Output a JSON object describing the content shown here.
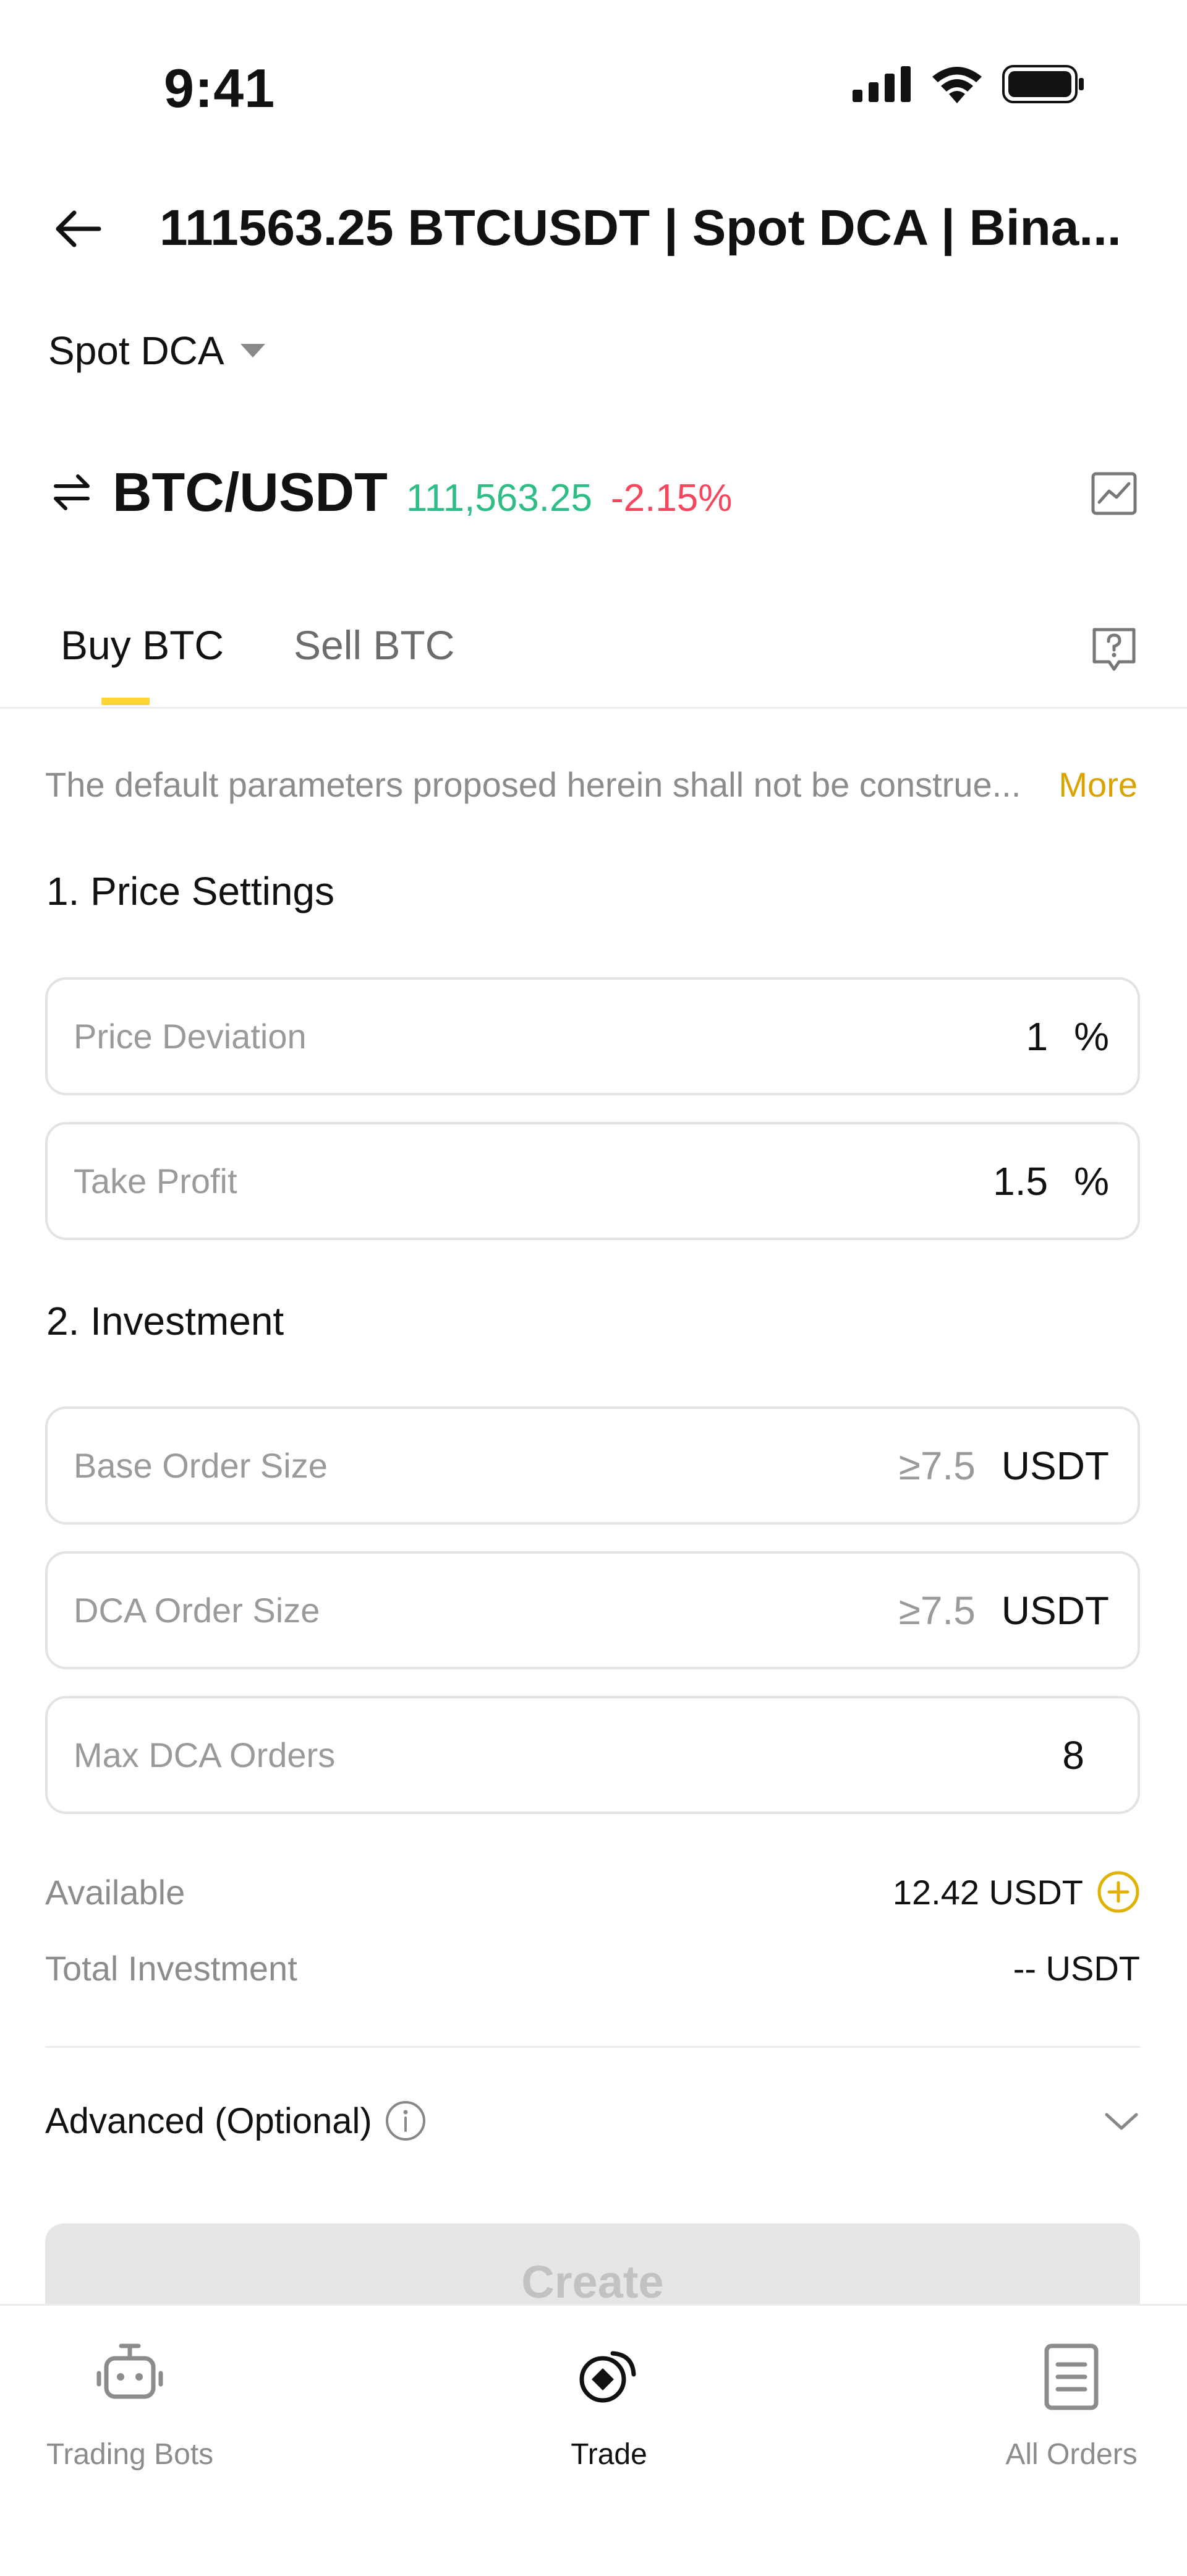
{
  "status_bar": {
    "time": "9:41"
  },
  "header": {
    "title": "111563.25 BTCUSDT | Spot DCA | Bina..."
  },
  "strategy": {
    "selected": "Spot DCA"
  },
  "pair": {
    "symbol": "BTC/USDT",
    "price": "111,563.25",
    "change": "-2.15%",
    "price_color": "#2ebd85",
    "change_color": "#f6465d"
  },
  "tabs": [
    {
      "label": "Buy BTC",
      "active": true
    },
    {
      "label": "Sell BTC",
      "active": false
    }
  ],
  "disclaimer": {
    "text": "The default parameters proposed herein shall not be construe...",
    "more": "More"
  },
  "price_settings": {
    "title": "1. Price Settings",
    "price_deviation": {
      "label": "Price Deviation",
      "value": "1",
      "unit": "%"
    },
    "take_profit": {
      "label": "Take Profit",
      "value": "1.5",
      "unit": "%"
    }
  },
  "investment": {
    "title": "2. Investment",
    "base_order": {
      "label": "Base Order Size",
      "placeholder": "≥7.5",
      "unit": "USDT"
    },
    "dca_order": {
      "label": "DCA Order Size",
      "placeholder": "≥7.5",
      "unit": "USDT"
    },
    "max_orders": {
      "label": "Max DCA Orders",
      "value": "8"
    }
  },
  "available": {
    "label": "Available",
    "value": "12.42 USDT"
  },
  "total_investment": {
    "label": "Total Investment",
    "value": "-- USDT"
  },
  "advanced": {
    "label": "Advanced (Optional)"
  },
  "create_button": {
    "label": "Create"
  },
  "bottom_nav": [
    {
      "label": "Trading Bots",
      "icon": "robot-icon",
      "active": false
    },
    {
      "label": "Trade",
      "icon": "trade-icon",
      "active": true
    },
    {
      "label": "All Orders",
      "icon": "orders-icon",
      "active": false
    }
  ],
  "colors": {
    "accent": "#fcd535",
    "link": "#d9a400",
    "up": "#2ebd85",
    "down": "#f6465d"
  }
}
